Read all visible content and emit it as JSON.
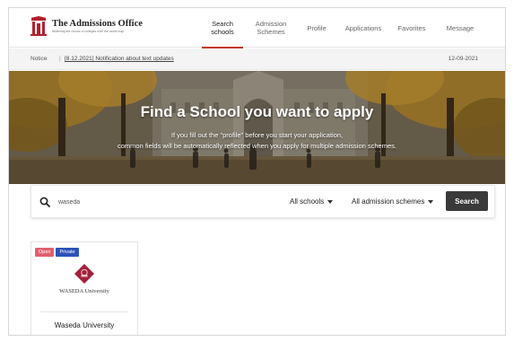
{
  "brand": {
    "title": "The Admissions Office",
    "subtitle": "Widening the choice of colleges from the world map"
  },
  "nav": {
    "items": [
      {
        "label": "Search schools",
        "active": true
      },
      {
        "label": "Admission Schemes",
        "active": false
      },
      {
        "label": "Profile",
        "active": false
      },
      {
        "label": "Applications",
        "active": false
      },
      {
        "label": "Favorites",
        "active": false
      },
      {
        "label": "Message",
        "active": false
      }
    ]
  },
  "notice": {
    "label": "Notice",
    "separator": "|",
    "text": "[8.12.2021] Notification about text updates",
    "date": "12-09-2021"
  },
  "hero": {
    "title": "Find a School you want to apply",
    "subtitle_line1": "If you fill out the \"profile\" before you start your application,",
    "subtitle_line2": "common fields will be automatically reflected when you apply for multiple admission schemes."
  },
  "search": {
    "value": "waseda",
    "school_filter": "All schools",
    "scheme_filter": "All admission schemes",
    "button_label": "Search"
  },
  "results": [
    {
      "badges": [
        "Open",
        "Private"
      ],
      "logo_text": "WASEDA University",
      "name": "Waseda University"
    }
  ],
  "colors": {
    "accent": "#c0392b",
    "badge_open": "#e0606e",
    "badge_private": "#2c52b8",
    "emblem": "#a3213a",
    "search_button": "#3a3a3a"
  }
}
